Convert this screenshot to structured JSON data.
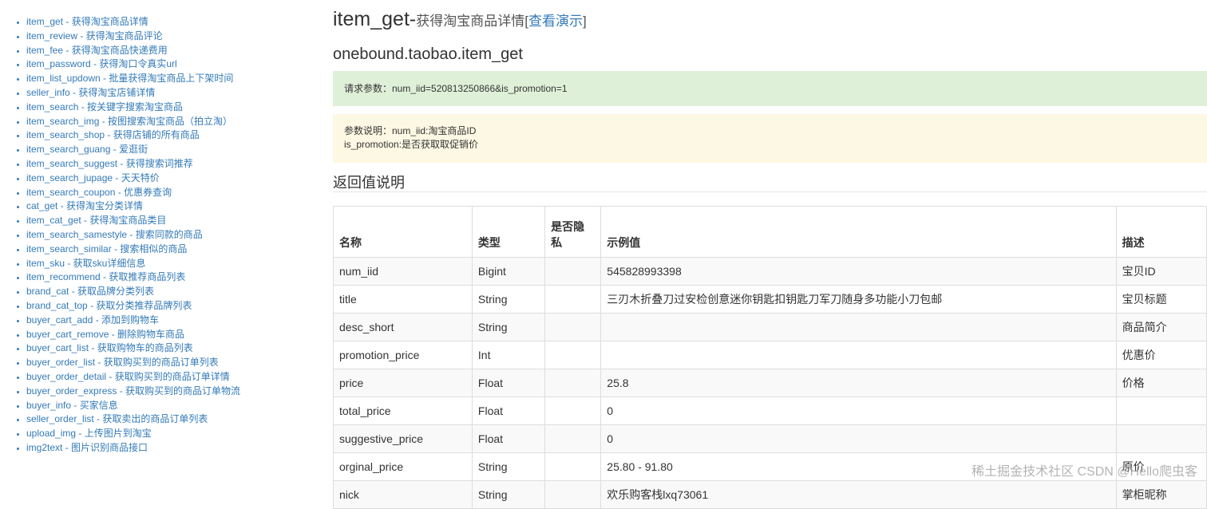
{
  "sidebar": {
    "items": [
      "item_get - 获得淘宝商品详情",
      "item_review - 获得淘宝商品评论",
      "item_fee - 获得淘宝商品快递费用",
      "item_password - 获得淘口令真实url",
      "item_list_updown - 批量获得淘宝商品上下架时间",
      "seller_info - 获得淘宝店铺详情",
      "item_search - 按关键字搜索淘宝商品",
      "item_search_img - 按图搜索淘宝商品（拍立淘）",
      "item_search_shop - 获得店铺的所有商品",
      "item_search_guang - 爱逛街",
      "item_search_suggest - 获得搜索词推荐",
      "item_search_jupage - 天天特价",
      "item_search_coupon - 优惠券查询",
      "cat_get - 获得淘宝分类详情",
      "item_cat_get - 获得淘宝商品类目",
      "item_search_samestyle - 搜索同款的商品",
      "item_search_similar - 搜索相似的商品",
      "item_sku - 获取sku详细信息",
      "item_recommend - 获取推荐商品列表",
      "brand_cat - 获取品牌分类列表",
      "brand_cat_top - 获取分类推荐品牌列表",
      "buyer_cart_add - 添加到购物车",
      "buyer_cart_remove - 删除购物车商品",
      "buyer_cart_list - 获取购物车的商品列表",
      "buyer_order_list - 获取购买到的商品订单列表",
      "buyer_order_detail - 获取购买到的商品订单详情",
      "buyer_order_express - 获取购买到的商品订单物流",
      "buyer_info - 买家信息",
      "seller_order_list - 获取卖出的商品订单列表",
      "upload_img - 上传图片到淘宝",
      "img2text - 图片识别商品接口"
    ]
  },
  "header": {
    "title": "item_get-",
    "subtitle": "获得淘宝商品详情",
    "bracket_open": "[",
    "demo_link": "查看演示",
    "bracket_close": "]",
    "api_name": "onebound.taobao.item_get"
  },
  "request": {
    "params_text": "请求参数：num_iid=520813250866&is_promotion=1"
  },
  "params_desc": {
    "line1": "参数说明：num_iid:淘宝商品ID",
    "line2": "is_promotion:是否获取取促销价"
  },
  "return_section": {
    "title": "返回值说明"
  },
  "table": {
    "headers": [
      "名称",
      "类型",
      "是否隐私",
      "示例值",
      "描述"
    ],
    "rows": [
      [
        "num_iid",
        "Bigint",
        "",
        "545828993398",
        "宝贝ID"
      ],
      [
        "title",
        "String",
        "",
        "三刃木折叠刀过安检创意迷你钥匙扣钥匙刀军刀随身多功能小刀包邮",
        "宝贝标题"
      ],
      [
        "desc_short",
        "String",
        "",
        "",
        "商品简介"
      ],
      [
        "promotion_price",
        "Int",
        "",
        "",
        "优惠价"
      ],
      [
        "price",
        "Float",
        "",
        "25.8",
        "价格"
      ],
      [
        "total_price",
        "Float",
        "",
        "0",
        ""
      ],
      [
        "suggestive_price",
        "Float",
        "",
        "0",
        ""
      ],
      [
        "orginal_price",
        "String",
        "",
        "25.80 - 91.80",
        "原价"
      ],
      [
        "nick",
        "String",
        "",
        "欢乐购客栈lxq73061",
        "掌柜昵称"
      ]
    ]
  },
  "watermark": "稀土掘金技术社区 CSDN @Hello爬虫客"
}
